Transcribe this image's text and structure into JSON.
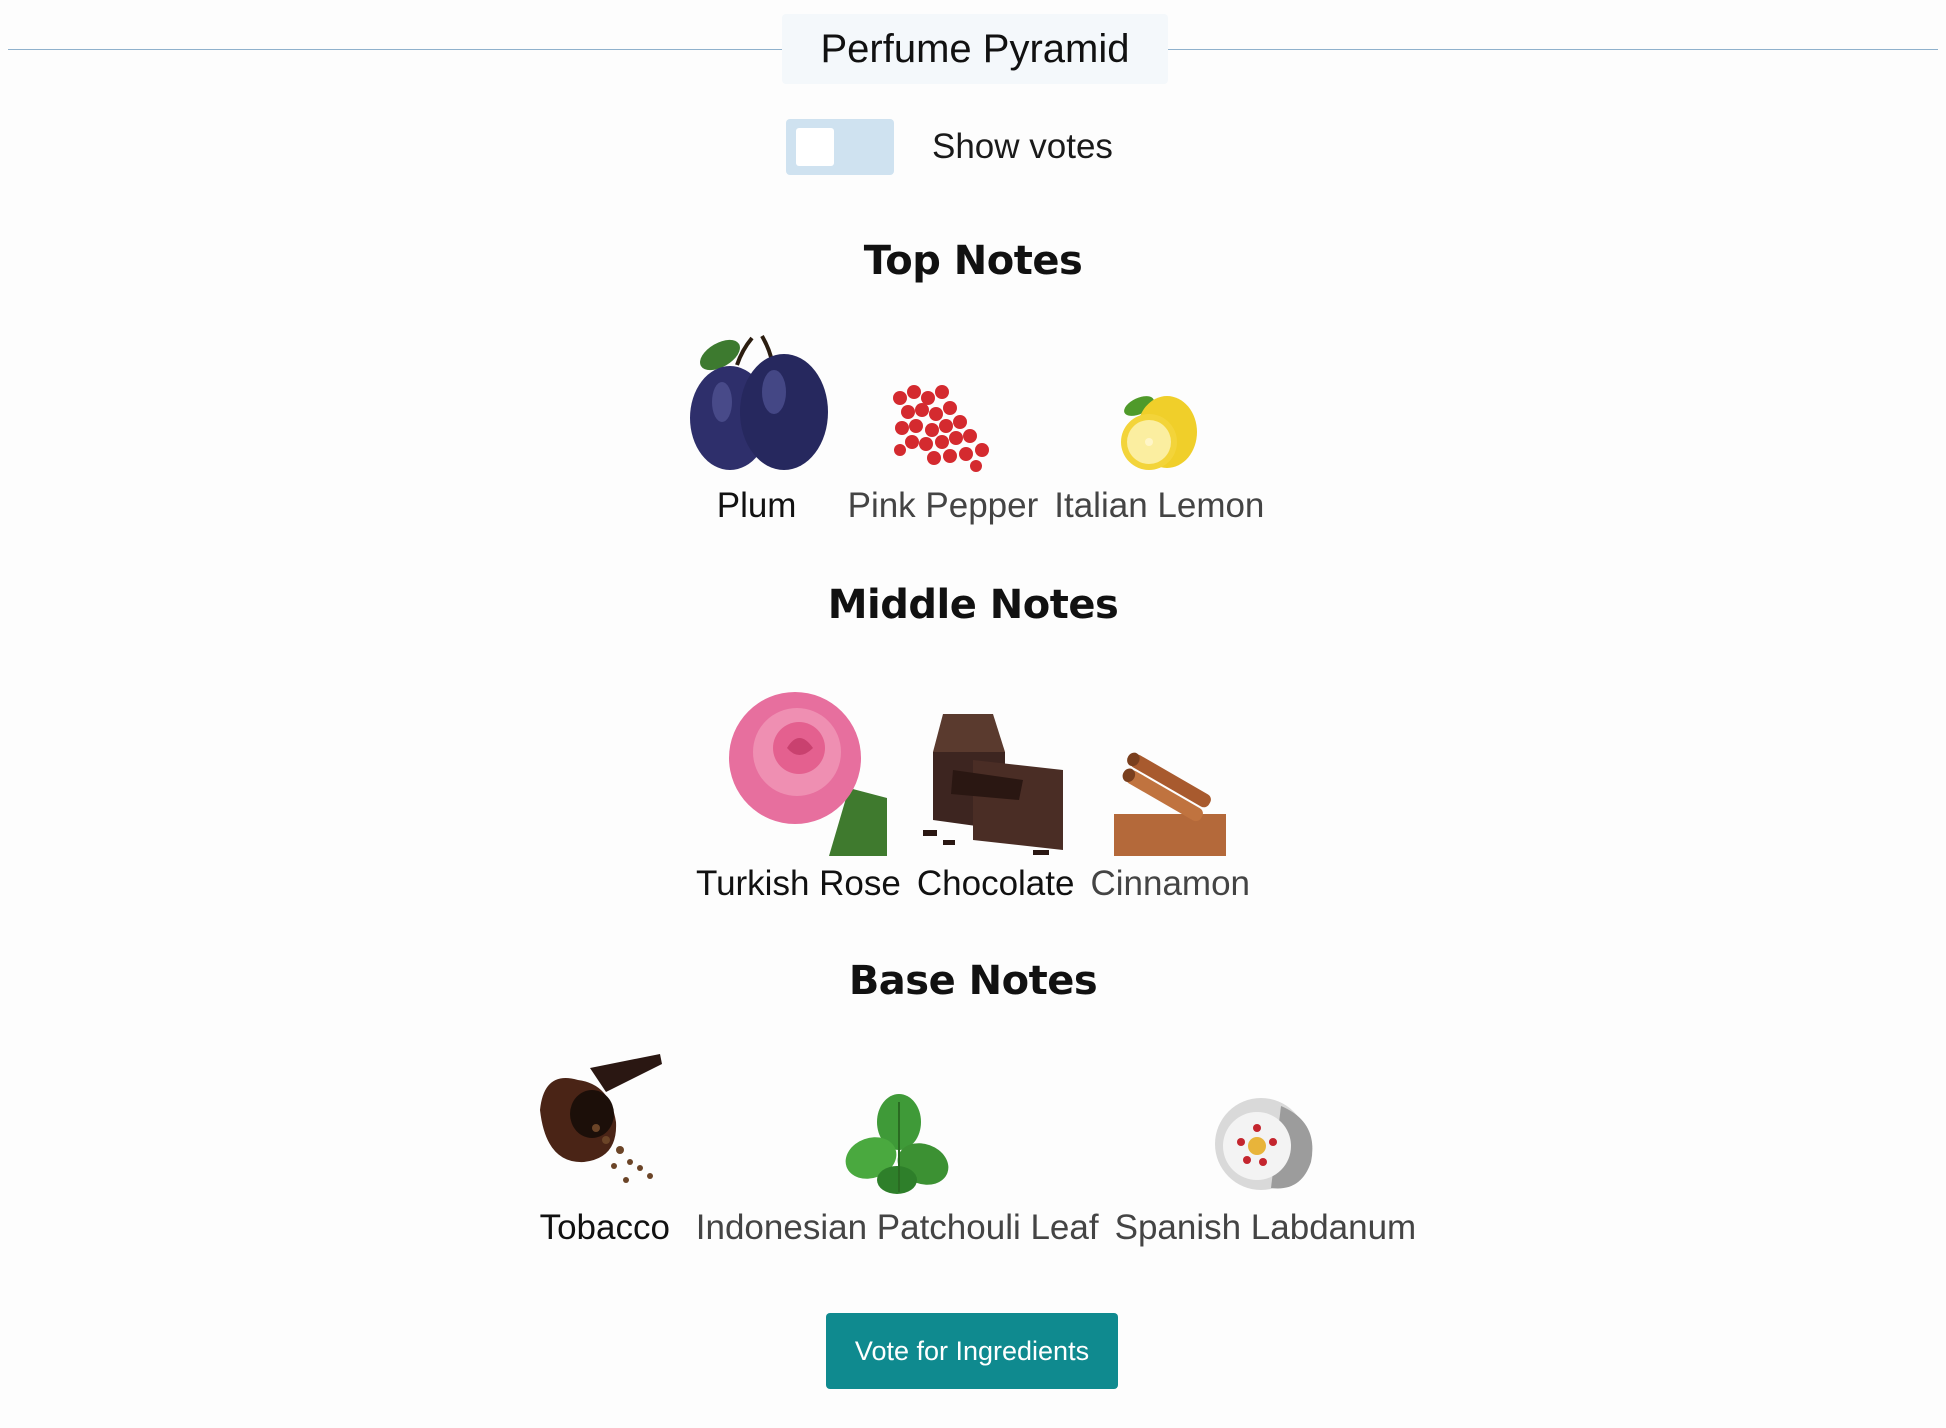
{
  "header": {
    "title": "Perfume Pyramid"
  },
  "toggle": {
    "label": "Show votes",
    "checked": false
  },
  "sections": {
    "top": {
      "title": "Top Notes",
      "notes": [
        {
          "label": "Plum",
          "icon": "plum-icon"
        },
        {
          "label": "Pink Pepper",
          "icon": "pink-pepper-icon"
        },
        {
          "label": "Italian Lemon",
          "icon": "lemon-icon"
        }
      ]
    },
    "middle": {
      "title": "Middle Notes",
      "notes": [
        {
          "label": "Turkish Rose",
          "icon": "rose-icon"
        },
        {
          "label": "Chocolate",
          "icon": "chocolate-icon"
        },
        {
          "label": "Cinnamon",
          "icon": "cinnamon-icon"
        }
      ]
    },
    "base": {
      "title": "Base Notes",
      "notes": [
        {
          "label": "Tobacco",
          "icon": "tobacco-pipe-icon"
        },
        {
          "label": "Indonesian Patchouli Leaf",
          "icon": "patchouli-leaf-icon"
        },
        {
          "label": "Spanish Labdanum",
          "icon": "labdanum-flower-icon"
        }
      ]
    }
  },
  "actions": {
    "vote_label": "Vote for Ingredients"
  },
  "colors": {
    "button": "#0f8a8f",
    "toggle_track": "#cfe2f0",
    "rule": "#8fb1cc"
  }
}
